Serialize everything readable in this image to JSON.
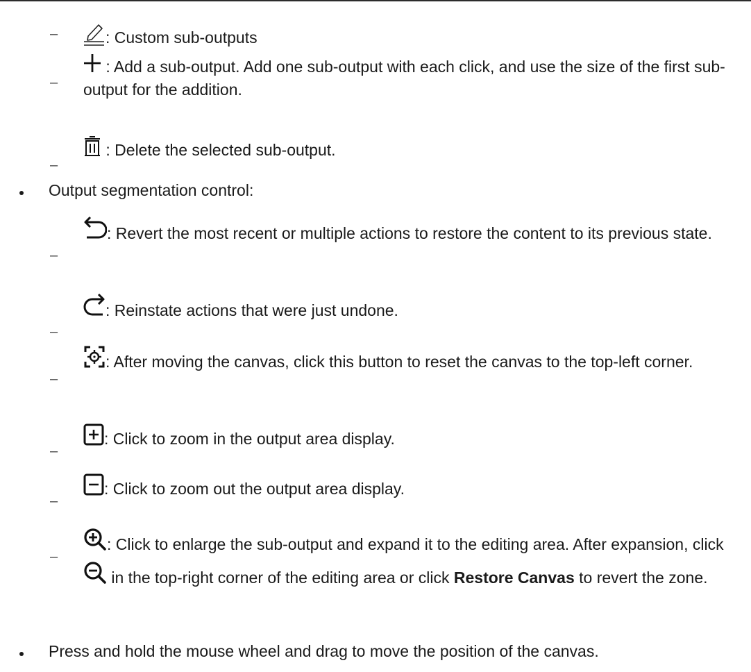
{
  "sub_output_items": [
    {
      "icon": "edit-pencil-icon",
      "text": ": Custom sub-outputs"
    },
    {
      "icon": "plus-icon",
      "text": " : Add a sub-output. Add one sub-output with each click, and use the size of the first sub-output for the addition."
    },
    {
      "icon": "trash-icon",
      "text": " : Delete the selected sub-output."
    }
  ],
  "bullet1": "Output segmentation control:",
  "segmentation_items": [
    {
      "icon": "undo-icon",
      "text": ": Revert the most recent or multiple actions to restore the content to its previous state."
    },
    {
      "icon": "redo-icon",
      "text": ": Reinstate actions that were just undone."
    },
    {
      "icon": "reset-position-icon",
      "text": ": After moving the canvas, click this button to reset the canvas to the top-left corner."
    },
    {
      "icon": "zoom-in-box-icon",
      "text": ": Click to zoom in the output area display."
    },
    {
      "icon": "zoom-out-box-icon",
      "text": ": Click to zoom out the output area display."
    }
  ],
  "enlarge_item": {
    "icon": "magnify-plus-icon",
    "text_a": ": Click to enlarge the sub-output and expand it to the editing area. After expansion, click ",
    "icon2": "magnify-minus-icon",
    "text_b": " in the top-right corner of the editing area or click ",
    "bold": "Restore Canvas",
    "text_c": " to revert the zone."
  },
  "bullet2": "Press and hold the mouse wheel and drag to move the position of the canvas."
}
